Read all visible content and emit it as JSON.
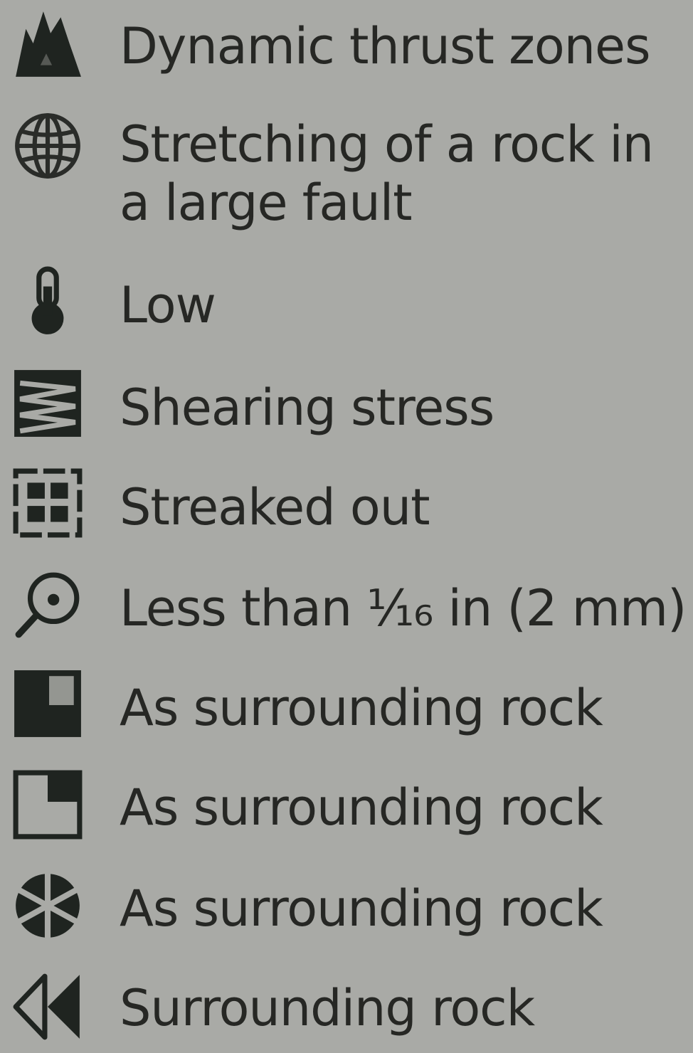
{
  "legend": {
    "items": [
      {
        "icon": "mountain-peaks-icon",
        "label": "Dynamic thrust zones"
      },
      {
        "icon": "globe-icon",
        "label": "Stretching of a rock in a large fault"
      },
      {
        "icon": "thermometer-icon",
        "label": "Low"
      },
      {
        "icon": "zigzag-layers-icon",
        "label": "Shearing stress"
      },
      {
        "icon": "grid-squares-icon",
        "label": "Streaked out"
      },
      {
        "icon": "magnifier-icon",
        "label": "Less than ⅟₁₆ in (2 mm)"
      },
      {
        "icon": "filled-square-icon",
        "label": "As surrounding rock"
      },
      {
        "icon": "corner-square-icon",
        "label": "As surrounding rock"
      },
      {
        "icon": "segmented-circle-icon",
        "label": "As surrounding rock"
      },
      {
        "icon": "double-left-arrow-icon",
        "label": "Surrounding rock"
      }
    ]
  }
}
